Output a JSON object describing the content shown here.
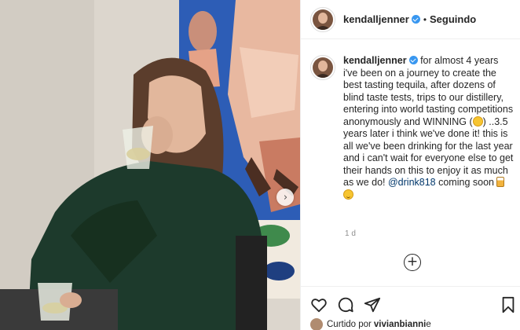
{
  "post": {
    "username": "kendalljenner",
    "separator": "•",
    "follow_label": "Seguindo",
    "caption_user": "kendalljenner",
    "caption_part1": " for almost 4 years i've been on a journey to create the best tasting tequila, after dozens of blind taste tests, trips to our distillery, entering into world tasting competitions anonymously and WINNING (",
    "caption_part2": ") ..3.5 years later i think we've done it! this is all we've been drinking for the last year and i can't wait for everyone else to get their hands on this to enjoy it as much as we do! ",
    "mention": "@drink818",
    "caption_part3": " coming soon ",
    "timestamp": "1 d",
    "liked_by_prefix": "Curtido por",
    "liked_by_user": "vivianbianni",
    "liked_by_suffix": " e"
  },
  "icons": {
    "verified": "verified-badge-icon",
    "like": "heart-outline-icon",
    "comment": "comment-bubble-icon",
    "share": "paper-plane-icon",
    "save": "bookmark-outline-icon",
    "carousel": "chevron-right-icon",
    "load_more": "plus-circle-icon"
  },
  "colors": {
    "verified": "#3897f0",
    "mention": "#00376b",
    "timestamp": "#8e8e8e"
  }
}
